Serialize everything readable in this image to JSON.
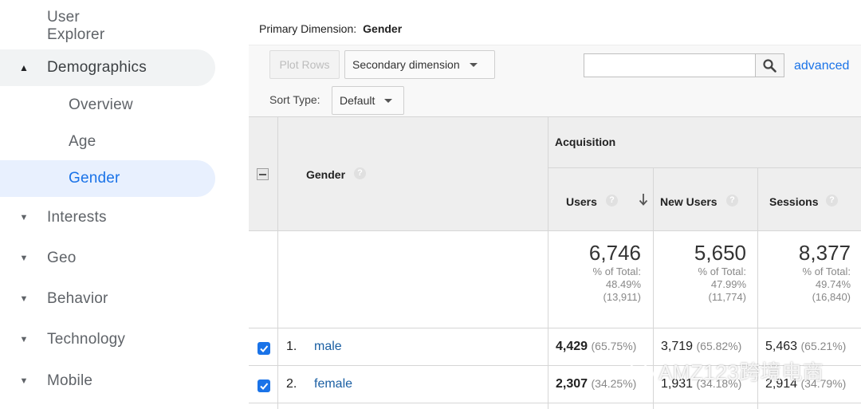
{
  "sidebar": {
    "user_explorer": "User Explorer",
    "demographics": "Demographics",
    "overview": "Overview",
    "age": "Age",
    "gender": "Gender",
    "interests": "Interests",
    "geo": "Geo",
    "behavior": "Behavior",
    "technology": "Technology",
    "mobile": "Mobile"
  },
  "primary_dimension": {
    "label": "Primary Dimension:",
    "value": "Gender"
  },
  "controls": {
    "plot_rows": "Plot Rows",
    "secondary_dimension": "Secondary dimension",
    "search_placeholder": "",
    "advanced": "advanced",
    "sort_type_label": "Sort Type:",
    "sort_type_value": "Default"
  },
  "table": {
    "dimension_header": "Gender",
    "group_header": "Acquisition",
    "columns": [
      "Users",
      "New Users",
      "Sessions"
    ],
    "totals": [
      {
        "value": "6,746",
        "pct_label": "% of Total:",
        "pct": "48.49%",
        "total": "(13,911)"
      },
      {
        "value": "5,650",
        "pct_label": "% of Total:",
        "pct": "47.99%",
        "total": "(11,774)"
      },
      {
        "value": "8,377",
        "pct_label": "% of Total:",
        "pct": "49.74%",
        "total": "(16,840)"
      }
    ],
    "rows": [
      {
        "index": "1.",
        "name": "male",
        "users": "4,429",
        "users_pct": "(65.75%)",
        "new_users": "3,719",
        "new_users_pct": "(65.82%)",
        "sessions": "5,463",
        "sessions_pct": "(65.21%)"
      },
      {
        "index": "2.",
        "name": "female",
        "users": "2,307",
        "users_pct": "(34.25%)",
        "new_users": "1,931",
        "new_users_pct": "(34.18%)",
        "sessions": "2,914",
        "sessions_pct": "(34.79%)"
      }
    ]
  },
  "watermark": "AMZ123跨境电商",
  "colors": {
    "accent": "#1a73e8",
    "link": "#1a5fa3",
    "header_bg": "#eeeeee"
  }
}
